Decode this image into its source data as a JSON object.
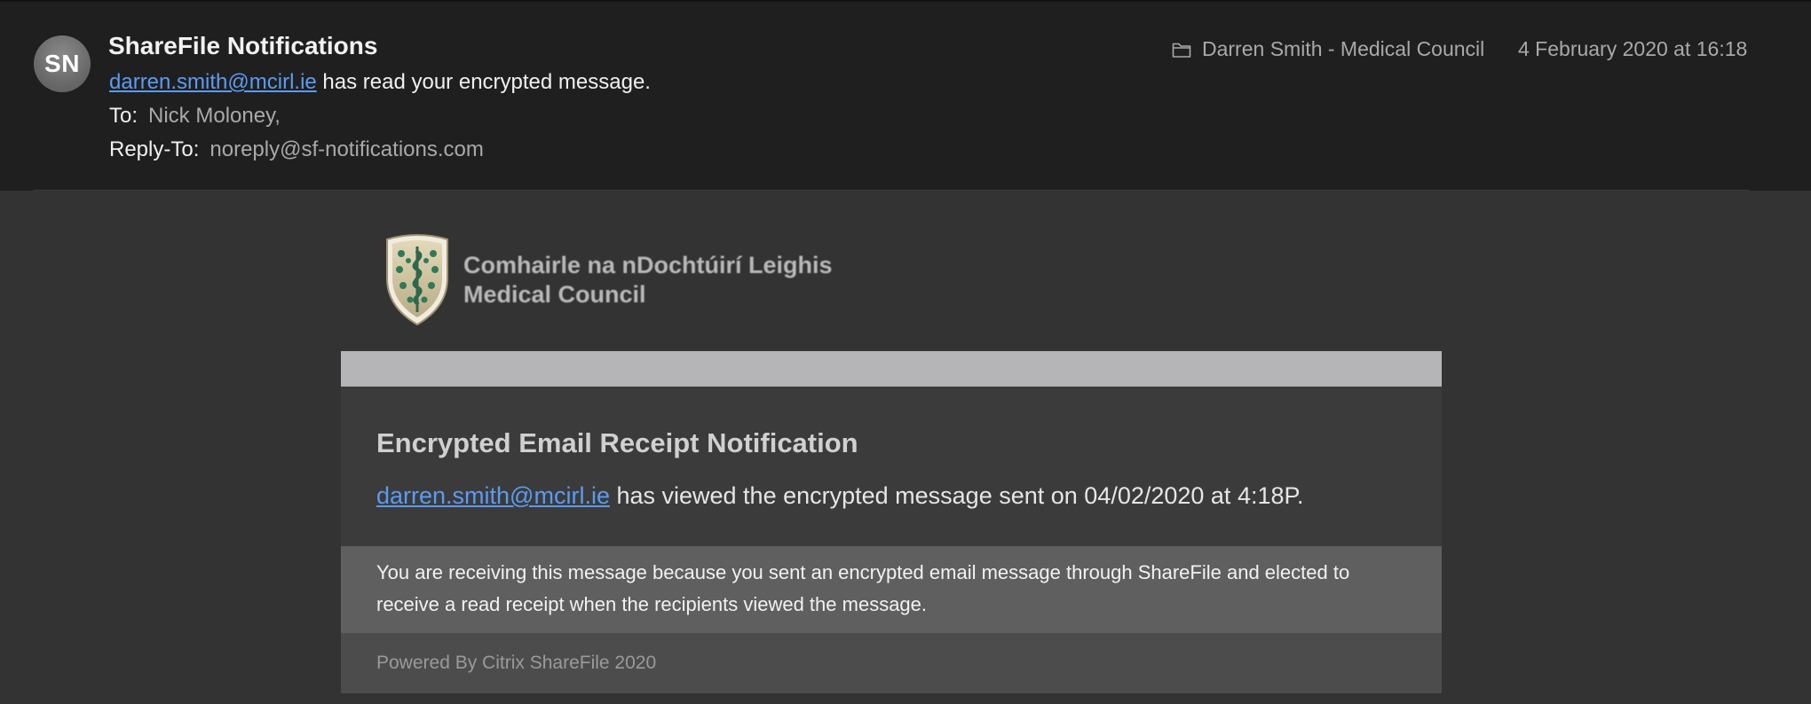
{
  "header": {
    "avatar_initials": "SN",
    "sender_name": "ShareFile Notifications",
    "summary_email": "darren.smith@mcirl.ie",
    "summary_text": " has read your encrypted message.",
    "to_label": "To:",
    "to_value": "Nick Moloney,",
    "reply_to_label": "Reply-To:",
    "reply_to_value": "noreply@sf-notifications.com",
    "folder_icon": "folder-icon",
    "folder_name": "Darren Smith - Medical Council",
    "date": "4 February 2020 at 16:18"
  },
  "logo": {
    "line1": "Comhairle na nDochtúirí Leighis",
    "line2": "Medical Council"
  },
  "card": {
    "title": "Encrypted Email Receipt Notification",
    "message_email": "darren.smith@mcirl.ie",
    "message_text": " has viewed the encrypted message sent on 04/02/2020 at 4:18P.",
    "notice": "You are receiving this message because you sent an encrypted email message through ShareFile and elected to receive a read receipt when the recipients viewed the message.",
    "footer": "Powered By Citrix ShareFile 2020"
  },
  "colors": {
    "header_bg": "#1f1f1f",
    "body_bg": "#333333",
    "link": "#5c9bf2",
    "band": "#b5b5b7",
    "notice_bg": "#5f5f5f"
  }
}
